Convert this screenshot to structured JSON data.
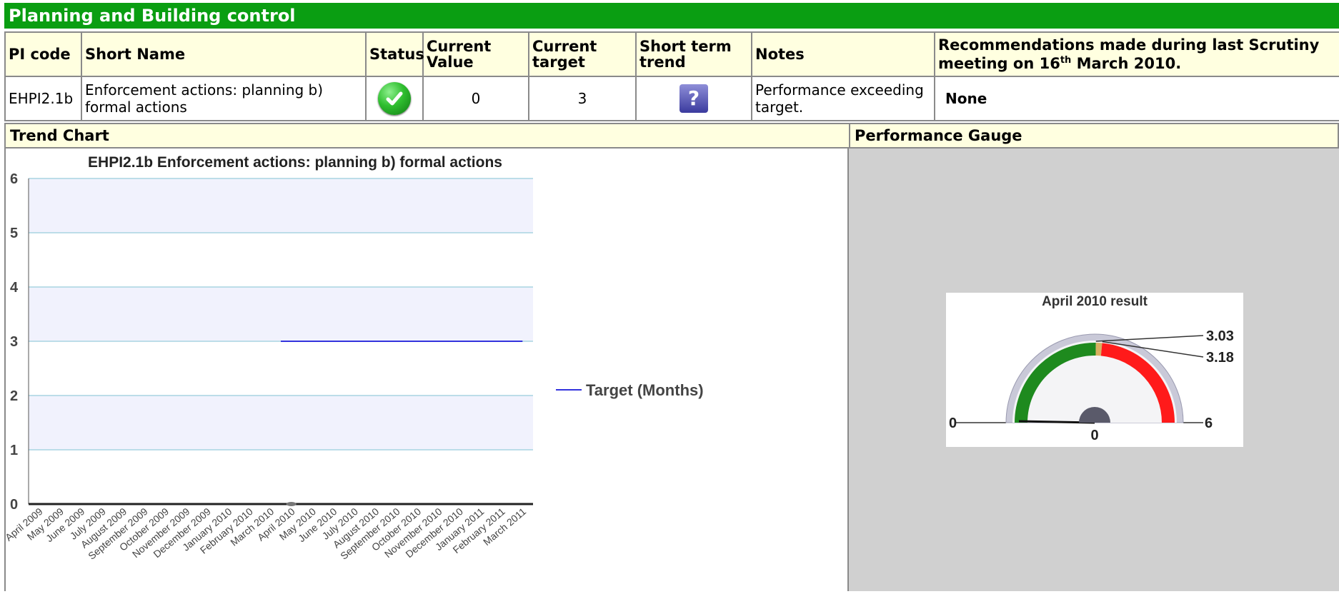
{
  "header": {
    "title": "Planning and Building control"
  },
  "table": {
    "columns": {
      "pi_code": "PI code",
      "short_name": "Short Name",
      "status": "Status",
      "current_value": "Current Value",
      "current_target": "Current target",
      "short_term_trend": "Short term trend",
      "notes": "Notes",
      "recommendations_prefix": "Recommendations made during last Scrutiny meeting on 16",
      "recommendations_sup": "th",
      "recommendations_suffix": " March 2010."
    },
    "row": {
      "pi_code": "EHPI2.1b",
      "short_name": "Enforcement actions: planning b) formal actions",
      "status_icon": "check-icon",
      "current_value": "0",
      "current_target": "3",
      "trend_icon": "question-icon",
      "trend_icon_glyph": "?",
      "notes": "Performance exceeding target.",
      "recommendations": "None"
    }
  },
  "sections": {
    "trend_chart": "Trend Chart",
    "performance_gauge": "Performance Gauge"
  },
  "chart_data": [
    {
      "type": "line",
      "title": "EHPI2.1b Enforcement actions: planning b) formal actions",
      "categories": [
        "April 2009",
        "May 2009",
        "June 2009",
        "July 2009",
        "August 2009",
        "September 2009",
        "October 2009",
        "November 2009",
        "December 2009",
        "January 2010",
        "February 2010",
        "March 2010",
        "April 2010",
        "May 2010",
        "June 2010",
        "July 2010",
        "August 2010",
        "September 2010",
        "October 2010",
        "November 2010",
        "December 2010",
        "January 2011",
        "February 2011",
        "March 2011"
      ],
      "series": [
        {
          "name": "Target (Months)",
          "color": "#3333dd",
          "values": [
            null,
            null,
            null,
            null,
            null,
            null,
            null,
            null,
            null,
            null,
            null,
            null,
            3,
            3,
            3,
            3,
            3,
            3,
            3,
            3,
            3,
            3,
            3,
            3
          ]
        },
        {
          "color": "#222222",
          "values": [
            0,
            0,
            0,
            0,
            0,
            0,
            0,
            0,
            0,
            0,
            0,
            0,
            0,
            null,
            null,
            null,
            null,
            null,
            null,
            null,
            null,
            null,
            null,
            null
          ]
        }
      ],
      "ylim": [
        0,
        6
      ],
      "yticks": [
        "0",
        "1",
        "2",
        "3",
        "4",
        "5",
        "6"
      ],
      "grid": true,
      "legend": "right"
    },
    {
      "type": "gauge",
      "title": "April 2010 result",
      "min": 0,
      "max": 6,
      "min_label": "0",
      "max_label": "6",
      "value": 0,
      "value_label": "0",
      "band_edge_1": 3.03,
      "band_edge_1_label": "3.03",
      "band_edge_2": 3.18,
      "band_edge_2_label": "3.18",
      "colors": {
        "good": "#1e8a1e",
        "mid": "#d8b060",
        "bad": "#ff1a1a"
      }
    }
  ]
}
